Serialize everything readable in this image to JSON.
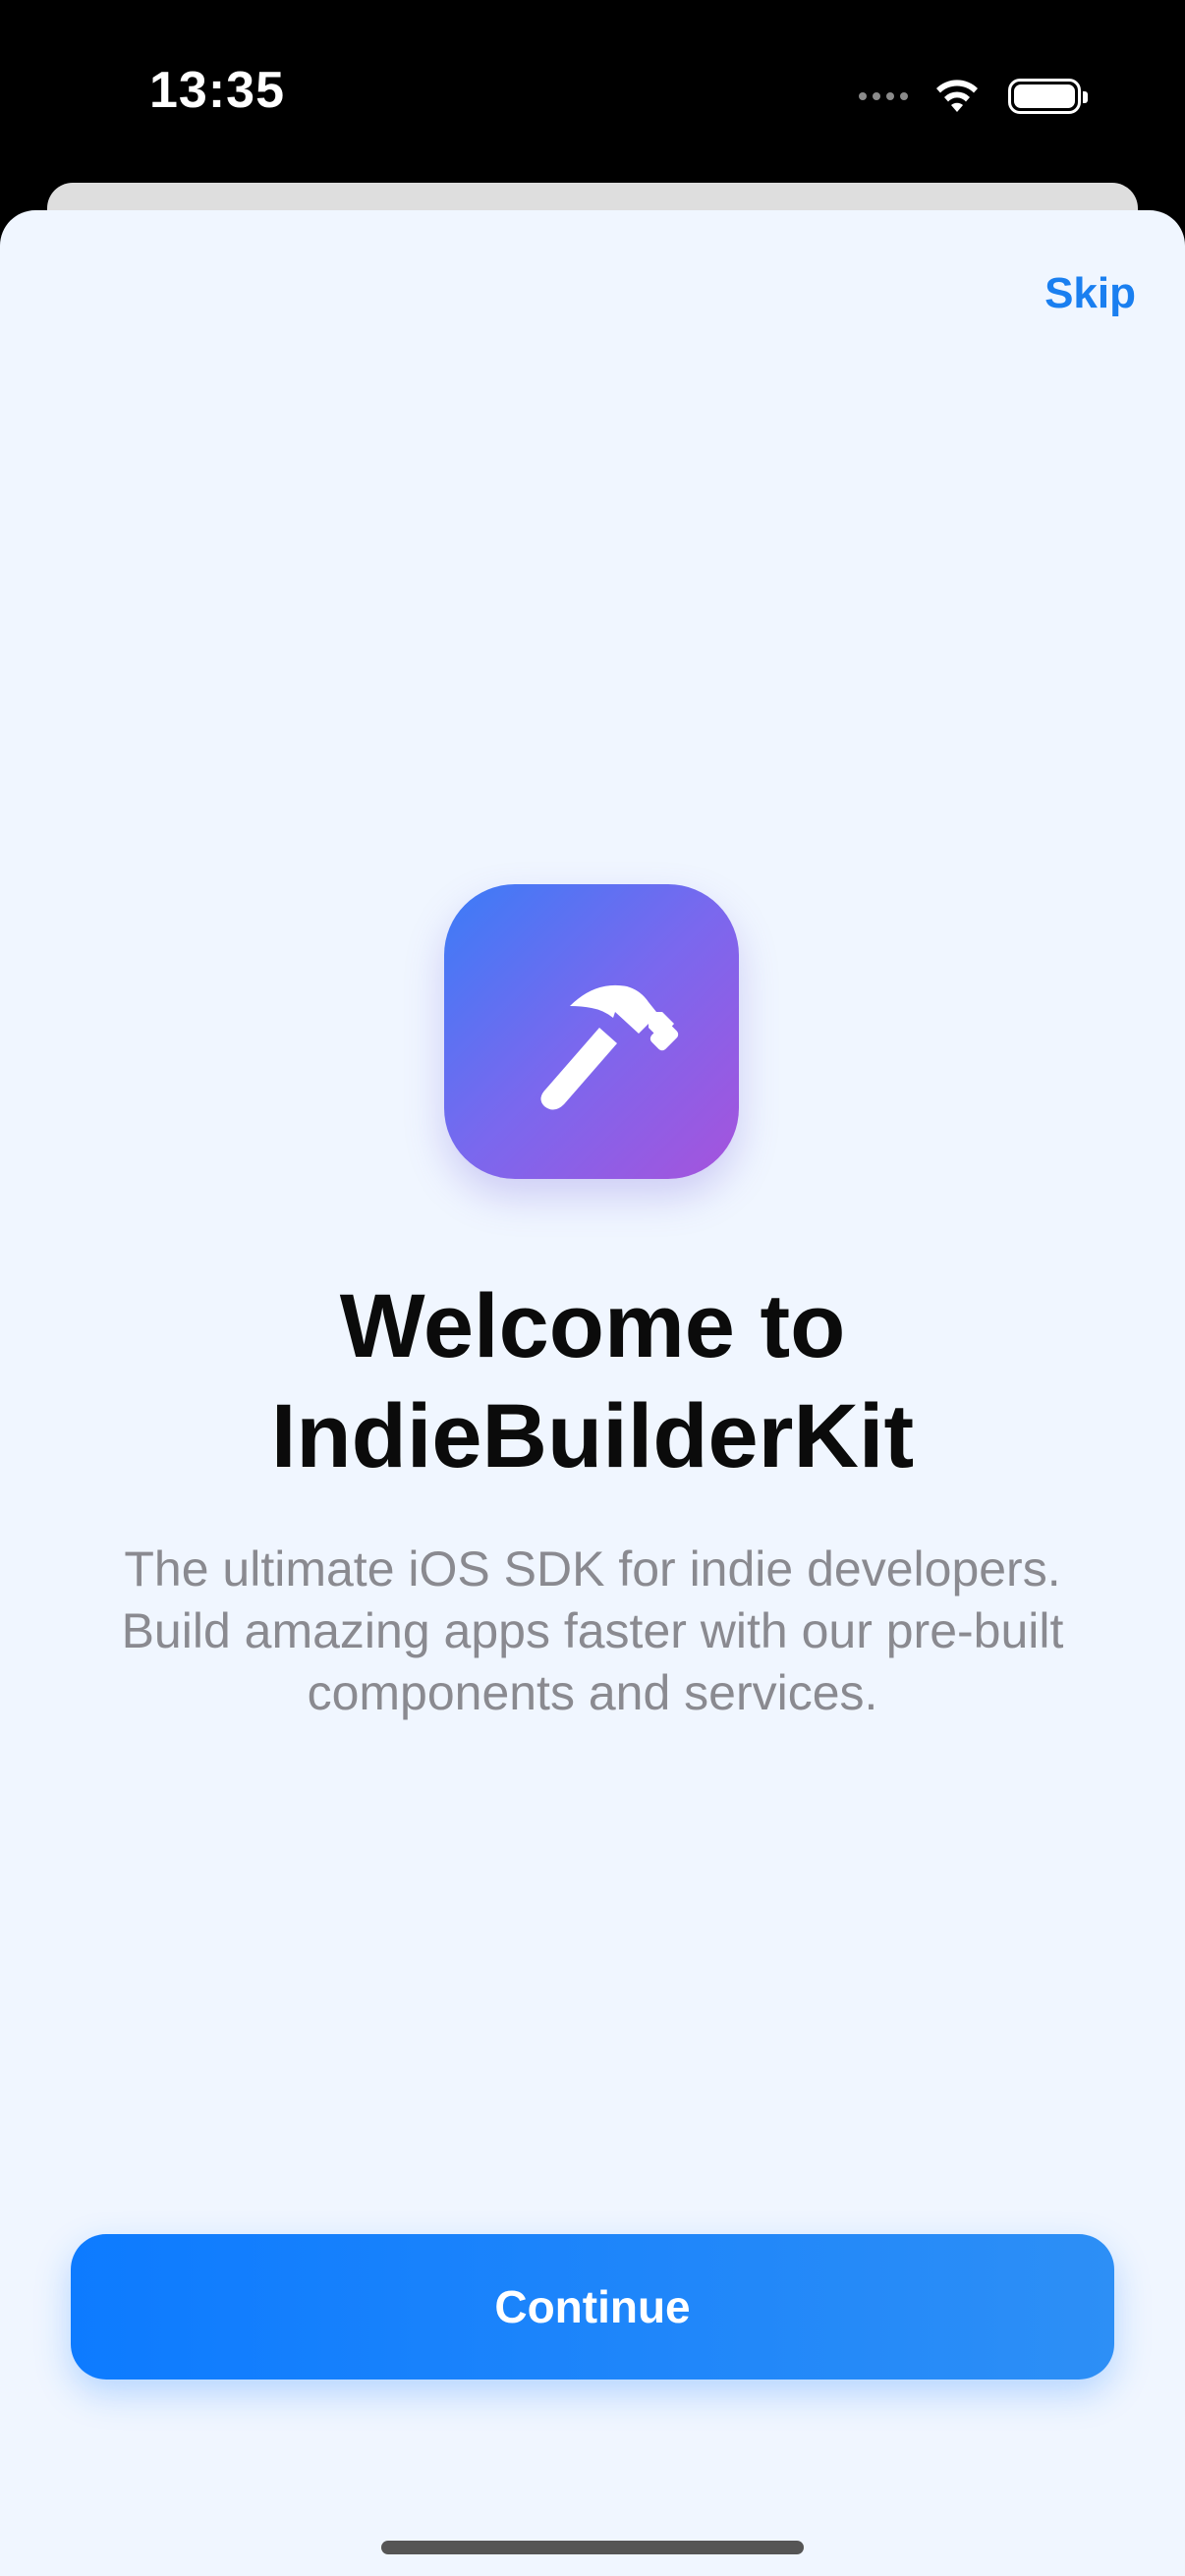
{
  "status_bar": {
    "time": "13:35",
    "icons": [
      "signal-dots-icon",
      "wifi-icon",
      "battery-icon"
    ]
  },
  "onboarding": {
    "skip_label": "Skip",
    "app_icon": "hammer-icon",
    "title_line1": "Welcome to",
    "title_line2": "IndieBuilderKit",
    "subtitle_line1": "The ultimate iOS SDK for indie developers.",
    "subtitle_line2": "Build amazing apps faster with our pre-built",
    "subtitle_line3": "components and services.",
    "continue_label": "Continue"
  },
  "colors": {
    "accent": "#1a7ff0",
    "sheet_background": "#f0f6ff",
    "icon_gradient_start": "#3b7cf7",
    "icon_gradient_end": "#a653dc",
    "subtitle": "#8a8a90"
  }
}
